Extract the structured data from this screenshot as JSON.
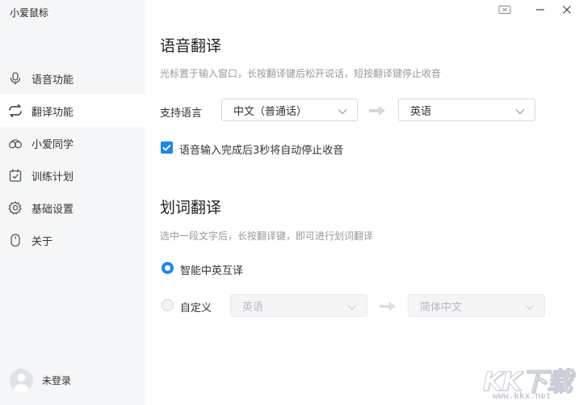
{
  "app": {
    "title": "小爱鼠标"
  },
  "sidebar": {
    "items": [
      {
        "label": "语音功能",
        "icon": "microphone-icon",
        "active": false
      },
      {
        "label": "翻译功能",
        "icon": "translate-icon",
        "active": true
      },
      {
        "label": "小爱同学",
        "icon": "xiaoai-icon",
        "active": false
      },
      {
        "label": "训练计划",
        "icon": "calendar-check-icon",
        "active": false
      },
      {
        "label": "基础设置",
        "icon": "gear-icon",
        "active": false
      },
      {
        "label": "关于",
        "icon": "mouse-icon",
        "active": false
      }
    ],
    "user": {
      "label": "未登录",
      "icon": "avatar-icon"
    }
  },
  "window": {
    "controls": [
      "mini-mode-icon",
      "minimize-icon",
      "close-icon"
    ]
  },
  "voice_translation": {
    "title": "语音翻译",
    "description": "光标置于输入窗口，长按翻译键后松开说话，短按翻译键停止收音",
    "language_label": "支持语言",
    "source_language": "中文（普通话）",
    "target_language": "英语",
    "auto_stop_label": "语音输入完成后3秒将自动停止收音",
    "auto_stop_checked": true
  },
  "word_translation": {
    "title": "划词翻译",
    "description": "选中一段文字后，长按翻译键，即可进行划词翻译",
    "smart_label": "智能中英互译",
    "smart_selected": true,
    "custom_label": "自定义",
    "custom_selected": false,
    "custom_source": "英语",
    "custom_target": "简体中文"
  },
  "watermark": {
    "logo": "KK下载",
    "url": "www.kkx.net"
  },
  "colors": {
    "accent": "#1e88e5",
    "sidebar_bg": "#f5f6f8"
  }
}
